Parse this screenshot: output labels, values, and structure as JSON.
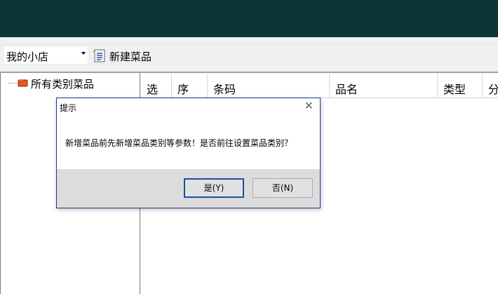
{
  "toolbar": {
    "store_select_value": "我的小店",
    "new_dish_label": "新建菜品"
  },
  "tree": {
    "root_label": "所有类别菜品"
  },
  "grid": {
    "columns": [
      "选",
      "序",
      "条码",
      "品名",
      "类型",
      "分"
    ]
  },
  "dialog": {
    "title": "提示",
    "close_glyph": "✕",
    "message": "新增菜品前先新增菜品类别等参数！是否前往设置菜品类别？",
    "yes_label": "是(Y)",
    "no_label": "否(N)"
  },
  "colors": {
    "titlebar": "#0e3535",
    "dialog_border": "#1a3c8a",
    "primary_button_border": "#1a4fa3"
  },
  "icons": {
    "new_dish": "document-list-icon",
    "tree_root": "orange-folder-icon"
  }
}
